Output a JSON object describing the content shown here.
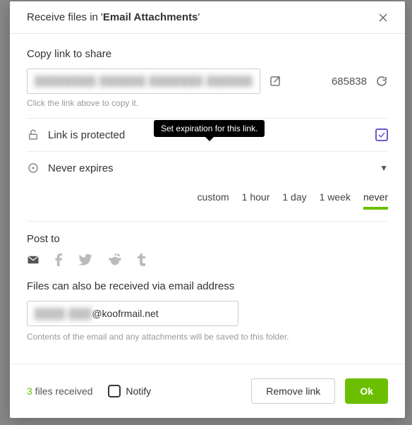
{
  "header": {
    "prefix": "Receive files in '",
    "folder": "Email Attachments",
    "suffix": "'"
  },
  "share": {
    "title": "Copy link to share",
    "link_masked": "████████ ██████ ███████ ██████",
    "code": "685838",
    "hint": "Click the link above to copy it."
  },
  "protection": {
    "label": "Link is protected",
    "tooltip": "Set expiration for this link."
  },
  "expiration": {
    "label": "Never expires",
    "options": [
      "custom",
      "1 hour",
      "1 day",
      "1 week",
      "never"
    ],
    "active": "never"
  },
  "post": {
    "title": "Post to"
  },
  "email": {
    "title": "Files can also be received via email address",
    "masked_user": "████ ███",
    "domain": "@koofrmail.net",
    "hint": "Contents of the email and any attachments will be saved to this folder."
  },
  "footer": {
    "files_count": "3",
    "files_label": " files received",
    "notify": "Notify",
    "remove": "Remove link",
    "ok": "Ok"
  }
}
